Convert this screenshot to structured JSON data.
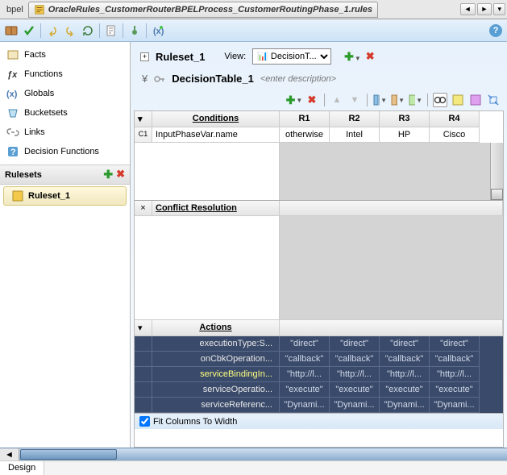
{
  "titlebar": {
    "prev_tab": "bpel",
    "filename": "OracleRules_CustomerRouterBPELProcess_CustomerRoutingPhase_1.rules"
  },
  "sidebar": {
    "items": [
      {
        "label": "Facts"
      },
      {
        "label": "Functions"
      },
      {
        "label": "Globals"
      },
      {
        "label": "Bucketsets"
      },
      {
        "label": "Links"
      },
      {
        "label": "Decision Functions"
      }
    ],
    "rulesets_label": "Rulesets",
    "ruleset_item": "Ruleset_1"
  },
  "ruleset_header": {
    "title": "Ruleset_1",
    "view_label": "View:",
    "view_value": "DecisionT..."
  },
  "decision_table": {
    "title": "DecisionTable_1",
    "desc_placeholder": "<enter description>"
  },
  "conditions": {
    "header": "Conditions",
    "rule_cols": [
      "R1",
      "R2",
      "R3",
      "R4"
    ],
    "rows": [
      {
        "id": "C1",
        "name": "InputPhaseVar.name",
        "vals": [
          "otherwise",
          "Intel",
          "HP",
          "Cisco"
        ]
      }
    ]
  },
  "conflict": {
    "header": "Conflict Resolution"
  },
  "actions": {
    "header": "Actions",
    "rows": [
      {
        "label": "executionType:S...",
        "vals": [
          "\"direct\"",
          "\"direct\"",
          "\"direct\"",
          "\"direct\""
        ]
      },
      {
        "label": "onCbkOperation...",
        "vals": [
          "\"callback\"",
          "\"callback\"",
          "\"callback\"",
          "\"callback\""
        ]
      },
      {
        "label": "serviceBindingIn...",
        "highlight": true,
        "vals": [
          "\"http://l...",
          "\"http://l...",
          "\"http://l...",
          "\"http://l..."
        ]
      },
      {
        "label": "serviceOperatio...",
        "vals": [
          "\"execute\"",
          "\"execute\"",
          "\"execute\"",
          "\"execute\""
        ]
      },
      {
        "label": "serviceReferenc...",
        "vals": [
          "\"Dynami...",
          "\"Dynami...",
          "\"Dynami...",
          "\"Dynami..."
        ]
      }
    ]
  },
  "fit_label": "Fit Columns To Width",
  "bottom_tab": "Design"
}
